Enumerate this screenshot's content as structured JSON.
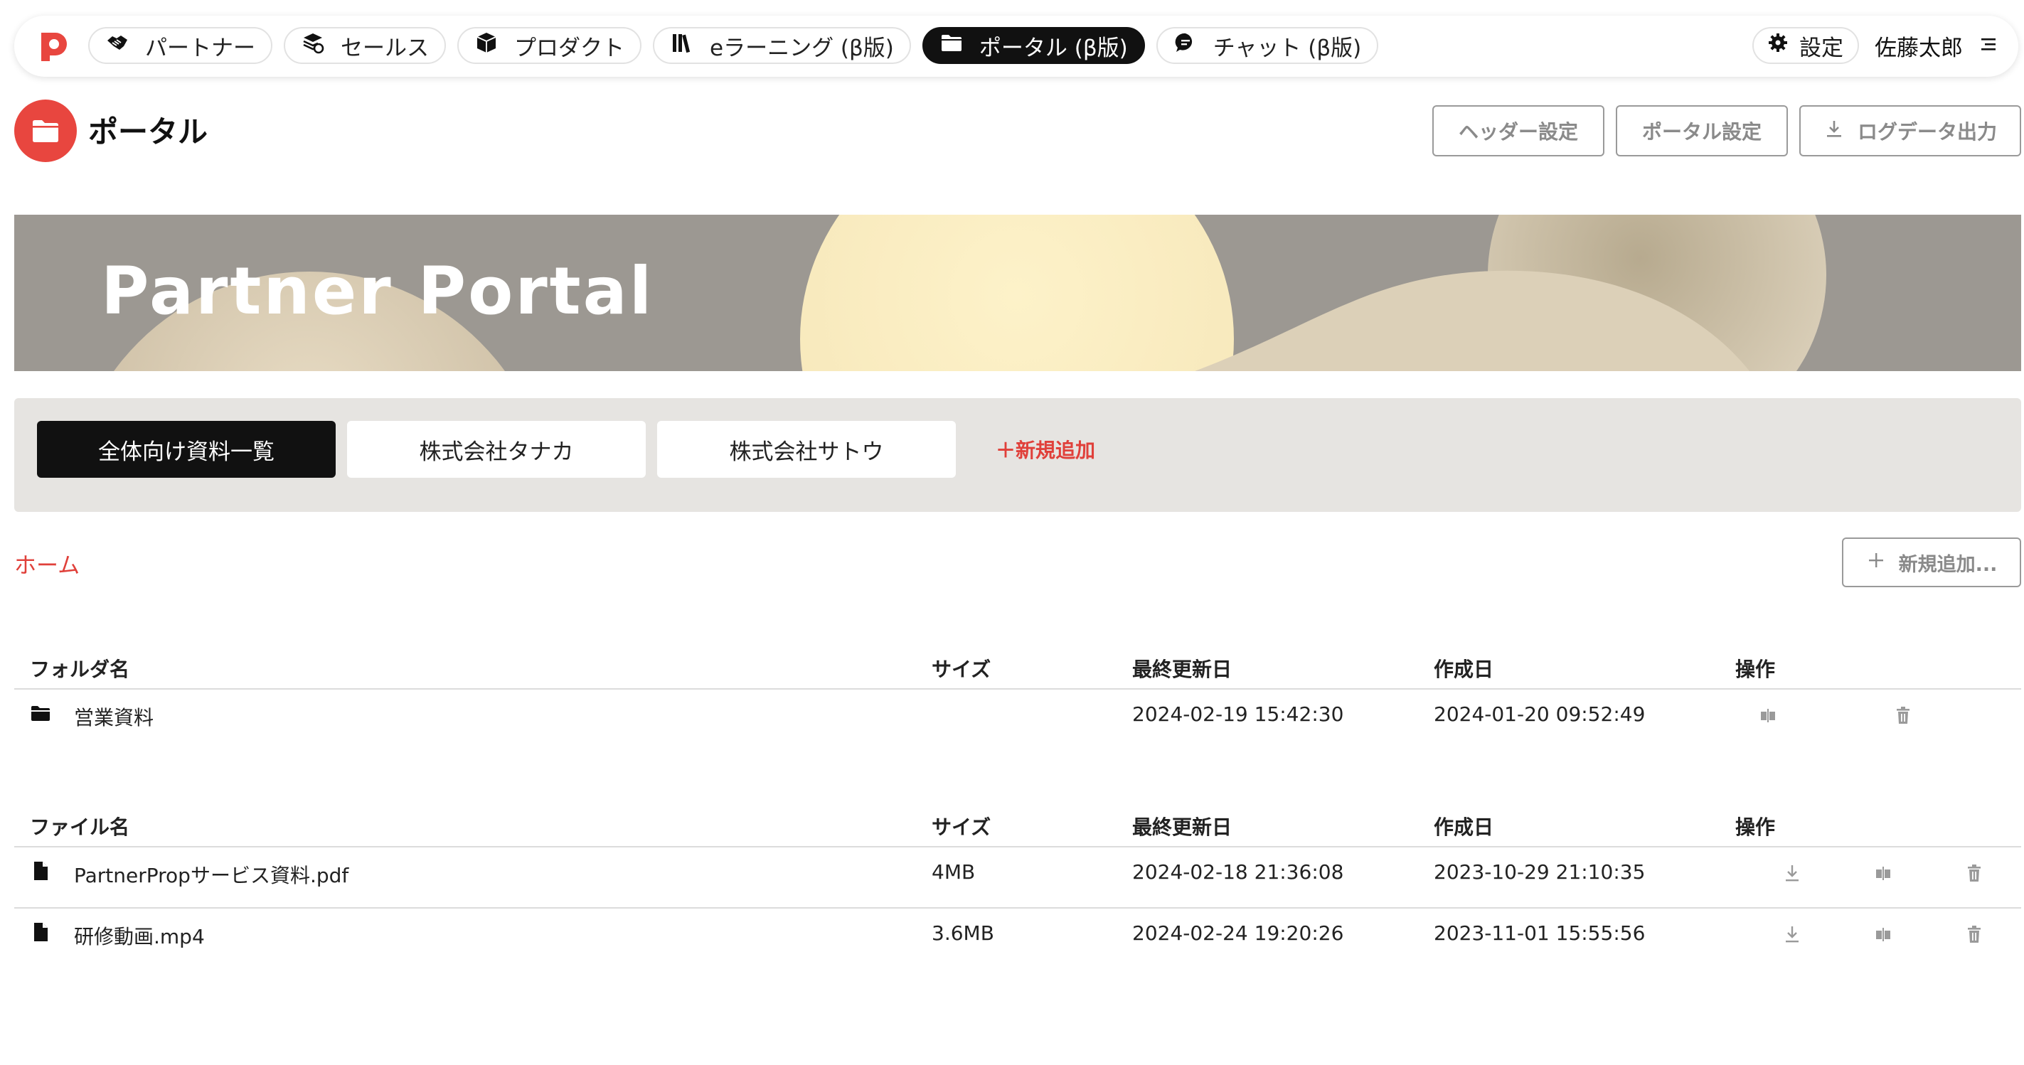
{
  "nav": {
    "items": [
      {
        "label": "パートナー",
        "icon": "handshake-icon",
        "active": false
      },
      {
        "label": "セールス",
        "icon": "sales-icon",
        "active": false
      },
      {
        "label": "プロダクト",
        "icon": "box-icon",
        "active": false
      },
      {
        "label": "eラーニング (β版)",
        "icon": "books-icon",
        "active": false
      },
      {
        "label": "ポータル (β版)",
        "icon": "folder-icon",
        "active": true
      },
      {
        "label": "チャット (β版)",
        "icon": "chat-icon",
        "active": false
      }
    ],
    "settings_label": "設定",
    "user_name": "佐藤太郎"
  },
  "page": {
    "title": "ポータル",
    "header_buttons": {
      "header_settings": "ヘッダー設定",
      "portal_settings": "ポータル設定",
      "log_export": "ログデータ出力"
    }
  },
  "banner": {
    "title": "Partner Portal"
  },
  "tabs": {
    "items": [
      {
        "label": "全体向け資料一覧",
        "active": true
      },
      {
        "label": "株式会社タナカ",
        "active": false
      },
      {
        "label": "株式会社サトウ",
        "active": false
      }
    ],
    "add_label": "＋新規追加"
  },
  "breadcrumb": {
    "home": "ホーム"
  },
  "add_new_label": "新規追加...",
  "folders_table": {
    "headers": {
      "name": "フォルダ名",
      "size": "サイズ",
      "updated": "最終更新日",
      "created": "作成日",
      "actions": "操作"
    },
    "rows": [
      {
        "name": "営業資料",
        "size": "",
        "updated": "2024-02-19 15:42:30",
        "created": "2024-01-20 09:52:49"
      }
    ]
  },
  "files_table": {
    "headers": {
      "name": "ファイル名",
      "size": "サイズ",
      "updated": "最終更新日",
      "created": "作成日",
      "actions": "操作"
    },
    "rows": [
      {
        "name": "PartnerPropサービス資料.pdf",
        "size": "4MB",
        "updated": "2024-02-18 21:36:08",
        "created": "2023-10-29 21:10:35"
      },
      {
        "name": "研修動画.mp4",
        "size": "3.6MB",
        "updated": "2024-02-24 19:20:26",
        "created": "2023-11-01 15:55:56"
      }
    ]
  },
  "colors": {
    "accent": "#e0403a",
    "active_dark": "#111111",
    "banner_bg": "#9c9892",
    "tabbar_bg": "#e6e4e1"
  }
}
